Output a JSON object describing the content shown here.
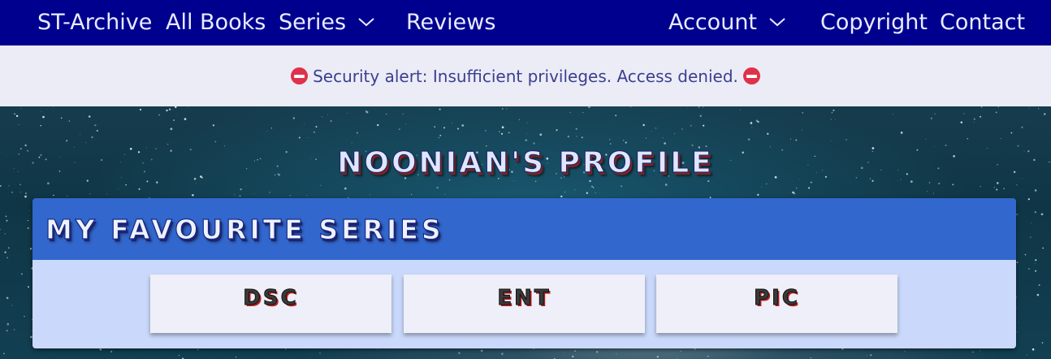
{
  "nav": {
    "brand": "ST-Archive",
    "all_books": "All Books",
    "series": "Series",
    "reviews": "Reviews",
    "account": "Account",
    "copyright": "Copyright",
    "contact": "Contact"
  },
  "alert": {
    "message": "Security alert: Insufficient privileges. Access denied.",
    "icon": "no-entry-icon"
  },
  "profile": {
    "title": "Noonian's Profile"
  },
  "favourites": {
    "heading": "My Favourite Series",
    "series": [
      "DSC",
      "ENT",
      "PIC"
    ]
  },
  "colors": {
    "navbar": "#00008f",
    "alert_bg": "#ececf7",
    "panel_header": "#3267cd",
    "panel_body": "#cad9fb",
    "alert_icon": "#e0314a"
  }
}
